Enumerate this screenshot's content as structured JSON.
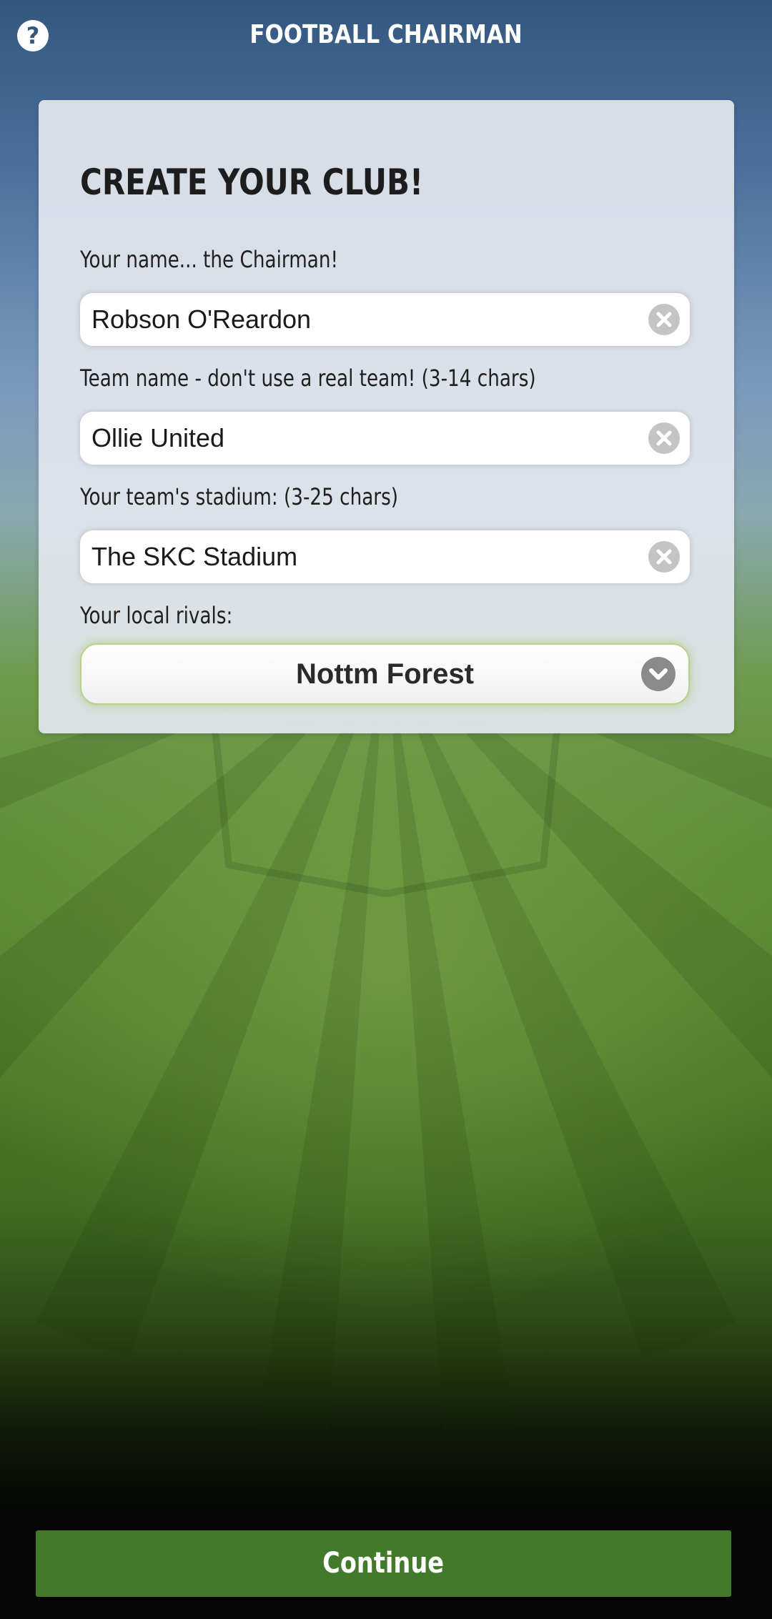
{
  "header": {
    "title": "FOOTBALL CHAIRMAN",
    "help_icon": "question-circle-icon",
    "help_glyph": "?"
  },
  "form": {
    "title": "CREATE YOUR CLUB!",
    "chairman": {
      "label": "Your name... the Chairman!",
      "value": "Robson O'Reardon"
    },
    "team": {
      "label": "Team name - don't use a real team! (3-14 chars)",
      "value": "Ollie United"
    },
    "stadium": {
      "label": "Your team's stadium: (3-25 chars)",
      "value": "The SKC Stadium"
    },
    "rivals": {
      "label": "Your local rivals:",
      "selected": "Nottm Forest"
    },
    "clear_icon": "clear-x-circle-icon",
    "dropdown_icon": "chevron-down-circle-icon"
  },
  "footer": {
    "continue_label": "Continue"
  },
  "colors": {
    "header_blue": "#33577f",
    "pitch_green": "#5f8d37",
    "button_green": "#42792a",
    "card_bg": "#e2e6ee"
  }
}
